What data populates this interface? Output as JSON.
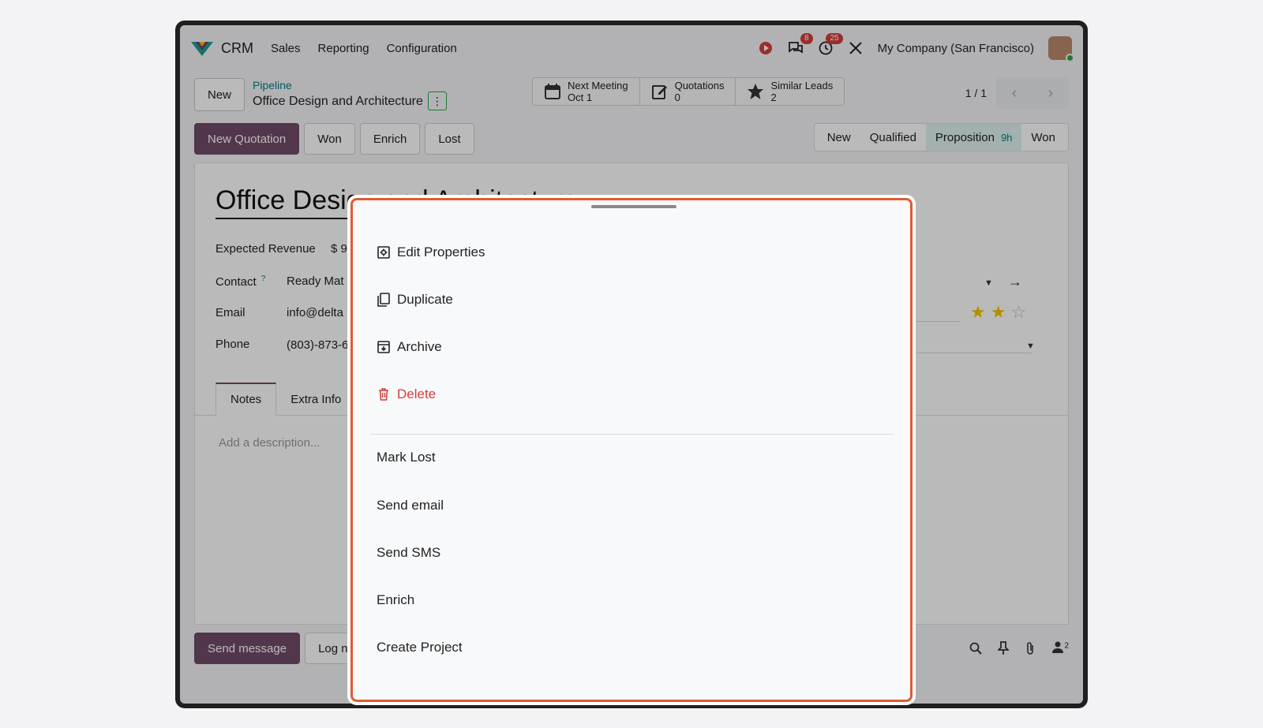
{
  "navbar": {
    "app_name": "CRM",
    "menu": [
      "Sales",
      "Reporting",
      "Configuration"
    ],
    "messages_badge": "8",
    "activities_badge": "25",
    "company": "My Company (San Francisco)"
  },
  "control_panel": {
    "new_label": "New",
    "breadcrumb_parent": "Pipeline",
    "breadcrumb_current": "Office Design and Architecture",
    "smart_buttons": {
      "meeting": {
        "label": "Next Meeting",
        "value": "Oct 1"
      },
      "quotations": {
        "label": "Quotations",
        "value": "0"
      },
      "similar": {
        "label": "Similar Leads",
        "value": "2"
      }
    },
    "pager_value": "1 / 1"
  },
  "actions": {
    "new_quotation": "New Quotation",
    "won": "Won",
    "enrich": "Enrich",
    "lost": "Lost"
  },
  "statusbar": {
    "stages": [
      "New",
      "Qualified",
      "Proposition",
      "Won"
    ],
    "active_stage": "Proposition",
    "active_duration": "9h"
  },
  "form": {
    "title": "Office Design and Architecture",
    "expected_revenue_label": "Expected Revenue",
    "expected_revenue_value": "$ 9",
    "contact_label": "Contact",
    "contact_help": "?",
    "contact_value": "Ready Mat",
    "email_label": "Email",
    "email_value": "info@delta",
    "phone_label": "Phone",
    "phone_value": "(803)-873-6",
    "priority_stars": 2,
    "priority_max": 3,
    "tabs": [
      "Notes",
      "Extra Info"
    ],
    "description_placeholder": "Add a description..."
  },
  "chatter": {
    "send_message": "Send message",
    "log_note": "Log n",
    "followers_count": "2"
  },
  "action_menu": {
    "edit_properties": "Edit Properties",
    "duplicate": "Duplicate",
    "archive": "Archive",
    "delete": "Delete",
    "mark_lost": "Mark Lost",
    "send_email": "Send email",
    "send_sms": "Send SMS",
    "enrich": "Enrich",
    "create_project": "Create Project"
  },
  "colors": {
    "primary": "#714b67",
    "accent_teal": "#017e84",
    "danger": "#d23f3a",
    "highlight_border": "#e05a36",
    "star": "#f3c600"
  }
}
